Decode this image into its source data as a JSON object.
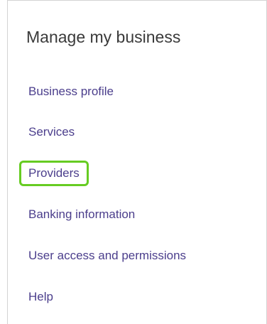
{
  "panel": {
    "title": "Manage my business",
    "link_color": "#4b3e8c",
    "highlight_color": "#66cc22",
    "items": [
      {
        "label": "Business profile",
        "highlighted": false
      },
      {
        "label": "Services",
        "highlighted": false
      },
      {
        "label": "Providers",
        "highlighted": true
      },
      {
        "label": "Banking information",
        "highlighted": false
      },
      {
        "label": "User access and permissions",
        "highlighted": false
      },
      {
        "label": "Help",
        "highlighted": false
      }
    ]
  }
}
